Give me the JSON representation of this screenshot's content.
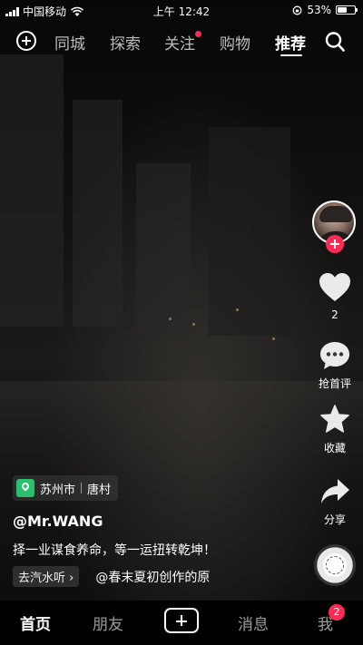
{
  "status_bar": {
    "carrier": "中国移动",
    "time": "上午 12:42",
    "battery": "53%",
    "battery_level": 0.53
  },
  "top_nav": {
    "tabs": [
      {
        "label": "同城",
        "active": false
      },
      {
        "label": "探索",
        "active": false
      },
      {
        "label": "关注",
        "active": false,
        "has_dot": true
      },
      {
        "label": "购物",
        "active": false
      },
      {
        "label": "推荐",
        "active": true
      }
    ],
    "icons": [
      "add-circle-icon",
      "search-icon"
    ]
  },
  "right_rail": {
    "like_count": "2",
    "comment_label": "抢首评",
    "favorite_label": "收藏",
    "share_label": "分享"
  },
  "video": {
    "location": {
      "city": "苏州市",
      "place": "唐村"
    },
    "username": "@Mr.WANG",
    "description": "择一业谋食养命，等一运扭转乾坤！",
    "music_tag": "去汽水听",
    "music_title": "@春末夏初创作的原"
  },
  "bottom_nav": {
    "items": [
      "首页",
      "朋友",
      "消息",
      "我"
    ],
    "active": "首页",
    "me_badge": "2"
  },
  "colors": {
    "accent": "#fe2c55",
    "location_pin": "#29c06b"
  }
}
